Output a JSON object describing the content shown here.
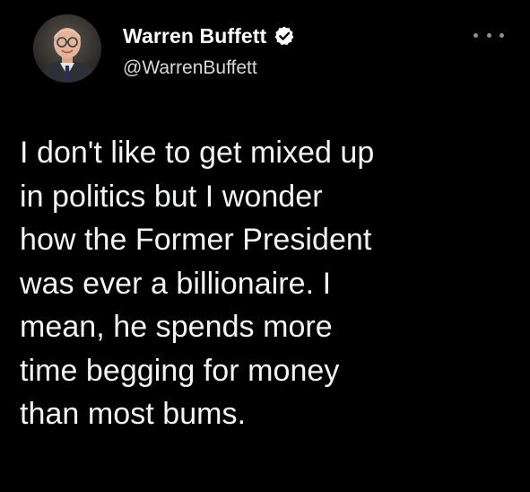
{
  "tweet": {
    "author": {
      "display_name": "Warren Buffett",
      "handle": "@WarrenBuffett",
      "verified": true,
      "verified_color": "#ffffff"
    },
    "more_icon": "more-horizontal-icon",
    "text_lines": [
      "I don't like to get mixed up",
      "in politics but I wonder",
      "how the Former President",
      "was ever a billionaire. I",
      "mean, he spends more",
      "time begging for money",
      "than most bums."
    ]
  },
  "colors": {
    "background": "#000000",
    "text": "#f2f4f5",
    "secondary_text": "#d6d9db"
  }
}
